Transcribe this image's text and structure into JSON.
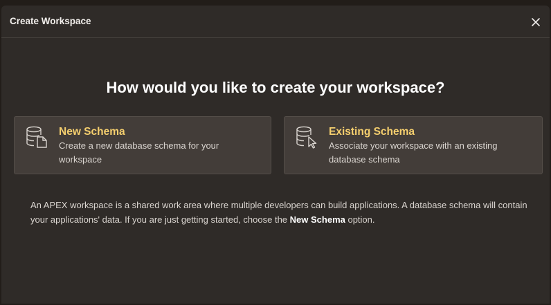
{
  "dialog": {
    "title": "Create Workspace",
    "close_icon": "close-icon"
  },
  "main": {
    "heading": "How would you like to create your workspace?",
    "options": [
      {
        "icon": "database-document-icon",
        "title": "New Schema",
        "description": "Create a new database schema for your workspace"
      },
      {
        "icon": "database-cursor-icon",
        "title": "Existing Schema",
        "description": "Associate your workspace with an existing database schema"
      }
    ],
    "info": {
      "text_before": "An APEX workspace is a shared work area where multiple developers can build applications. A database schema will contain your applications' data. If you are just getting started, choose the ",
      "emphasis": "New Schema",
      "text_after": " option."
    }
  },
  "colors": {
    "accent": "#f5cf6e",
    "dialog_bg": "#2f2b28",
    "card_bg": "#433d39"
  }
}
